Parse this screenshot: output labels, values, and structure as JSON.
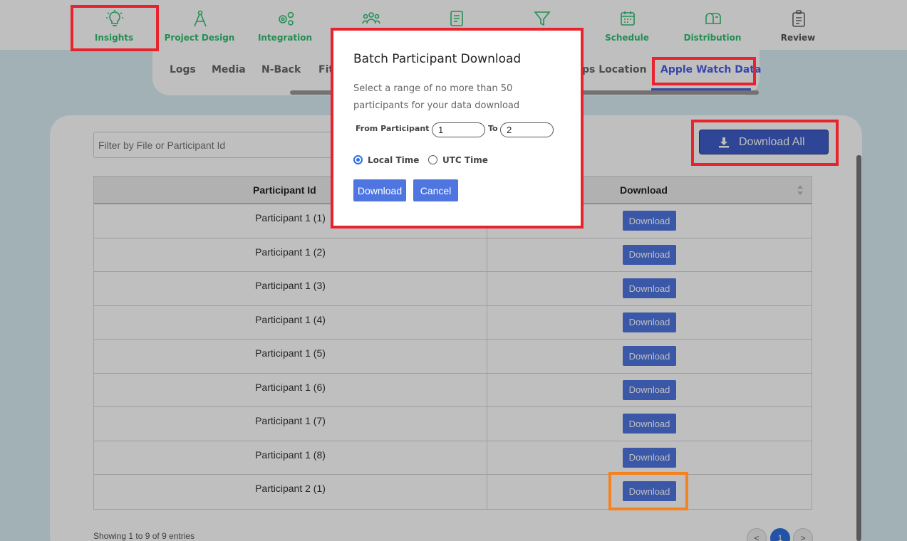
{
  "nav": {
    "items": [
      {
        "label": "Insights",
        "icon": "lightbulb-icon",
        "color": "green"
      },
      {
        "label": "Project Design",
        "icon": "compass-icon",
        "color": "green"
      },
      {
        "label": "Integration",
        "icon": "gears-icon",
        "color": "green"
      },
      {
        "label": "",
        "icon": "people-icon",
        "color": "green"
      },
      {
        "label": "",
        "icon": "document-icon",
        "color": "green"
      },
      {
        "label": "",
        "icon": "filter-icon",
        "color": "green"
      },
      {
        "label": "Schedule",
        "icon": "calendar-icon",
        "color": "green"
      },
      {
        "label": "Distribution",
        "icon": "mailbox-icon",
        "color": "green"
      },
      {
        "label": "Review",
        "icon": "clipboard-icon",
        "color": "gray"
      }
    ]
  },
  "subtabs": {
    "items": [
      "Logs",
      "Media",
      "N-Back",
      "Fit",
      "ps Location",
      "Apple Watch Data"
    ],
    "active": "Apple Watch Data"
  },
  "filter": {
    "placeholder": "Filter by File or Participant Id"
  },
  "download_all": {
    "label": "Download All"
  },
  "table": {
    "headers": [
      "Participant Id",
      "Download"
    ],
    "rows": [
      {
        "participant": "Participant 1 (1)",
        "action": "Download"
      },
      {
        "participant": "Participant 1 (2)",
        "action": "Download"
      },
      {
        "participant": "Participant 1 (3)",
        "action": "Download"
      },
      {
        "participant": "Participant 1 (4)",
        "action": "Download"
      },
      {
        "participant": "Participant 1 (5)",
        "action": "Download"
      },
      {
        "participant": "Participant 1 (6)",
        "action": "Download"
      },
      {
        "participant": "Participant 1 (7)",
        "action": "Download"
      },
      {
        "participant": "Participant 1 (8)",
        "action": "Download"
      },
      {
        "participant": "Participant 2 (1)",
        "action": "Download"
      }
    ]
  },
  "pagination": {
    "showing": "Showing 1 to 9 of 9 entries",
    "prev": "<",
    "current": "1",
    "next": ">"
  },
  "modal": {
    "title": "Batch Participant Download",
    "description": "Select a range of no more than 50 participants for your data download",
    "from_label": "From Participant",
    "from_value": "1",
    "to_label": "To",
    "to_value": "2",
    "local_time": "Local Time",
    "utc_time": "UTC Time",
    "selected_time": "Local Time",
    "download": "Download",
    "cancel": "Cancel"
  },
  "colors": {
    "nav_active": "#2fbf71",
    "tab_active": "#4b5ce6",
    "button_blue": "#4e75e0",
    "highlight_red": "#e8232d",
    "highlight_orange": "#f58220"
  }
}
